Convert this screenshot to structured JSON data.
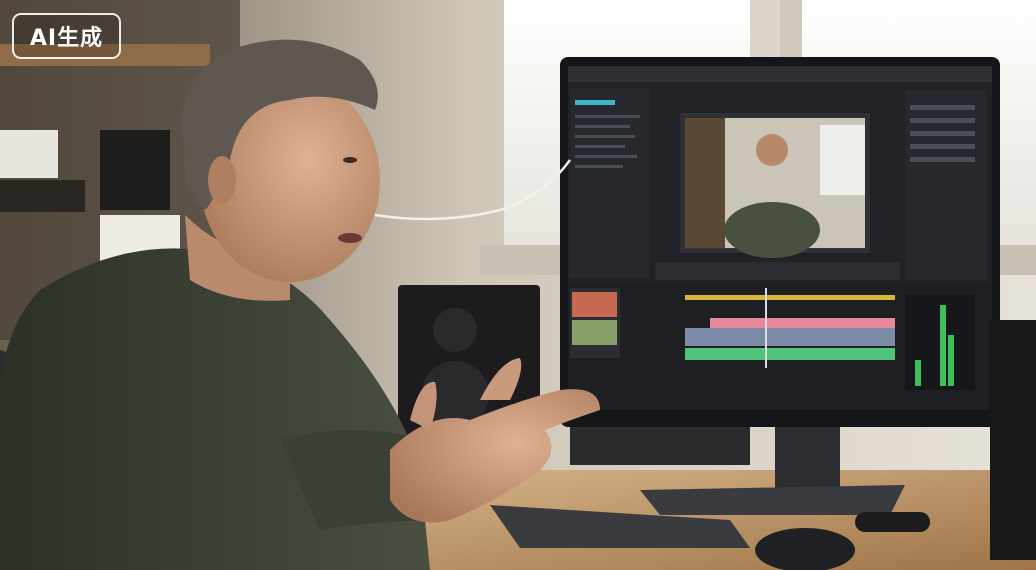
{
  "watermark": {
    "text": "AI生成"
  },
  "scene": {
    "subject": "man-gesturing-at-desk",
    "monitor_app": "video-editing-timeline",
    "colors": {
      "wall": "#d9d3c8",
      "window_light": "#f2f0ea",
      "sweater": "#3d4236",
      "skin": "#c99a7c",
      "hair": "#5e5850",
      "desk": "#b48a5e",
      "monitor_frame": "#1b1c1f",
      "ui_panel": "#23252b",
      "timeline_green": "#4fc37a",
      "timeline_pink": "#e8889a",
      "timeline_yellow": "#d8b63c",
      "meter_green": "#3fbf5a"
    }
  }
}
